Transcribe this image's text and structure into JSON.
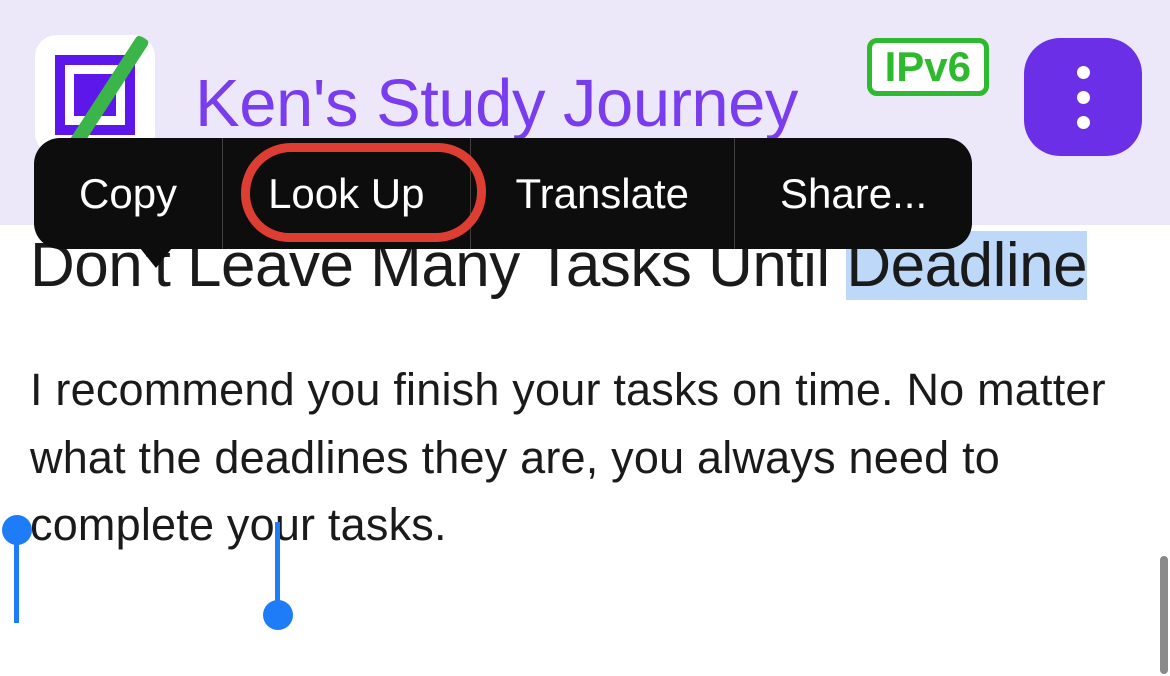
{
  "header": {
    "site_title": "Ken's Study Journey",
    "ipv6_label": "IPv6"
  },
  "context_menu": {
    "items": [
      {
        "label": "Copy"
      },
      {
        "label": "Look Up"
      },
      {
        "label": "Translate"
      },
      {
        "label": "Share..."
      }
    ]
  },
  "article": {
    "heading_part1": "Don't Leave Many Tasks Until ",
    "heading_selected": "Deadline",
    "paragraph": "I recommend you finish your tasks on time. No matter what the deadlines they are, you always need to complete your tasks."
  }
}
